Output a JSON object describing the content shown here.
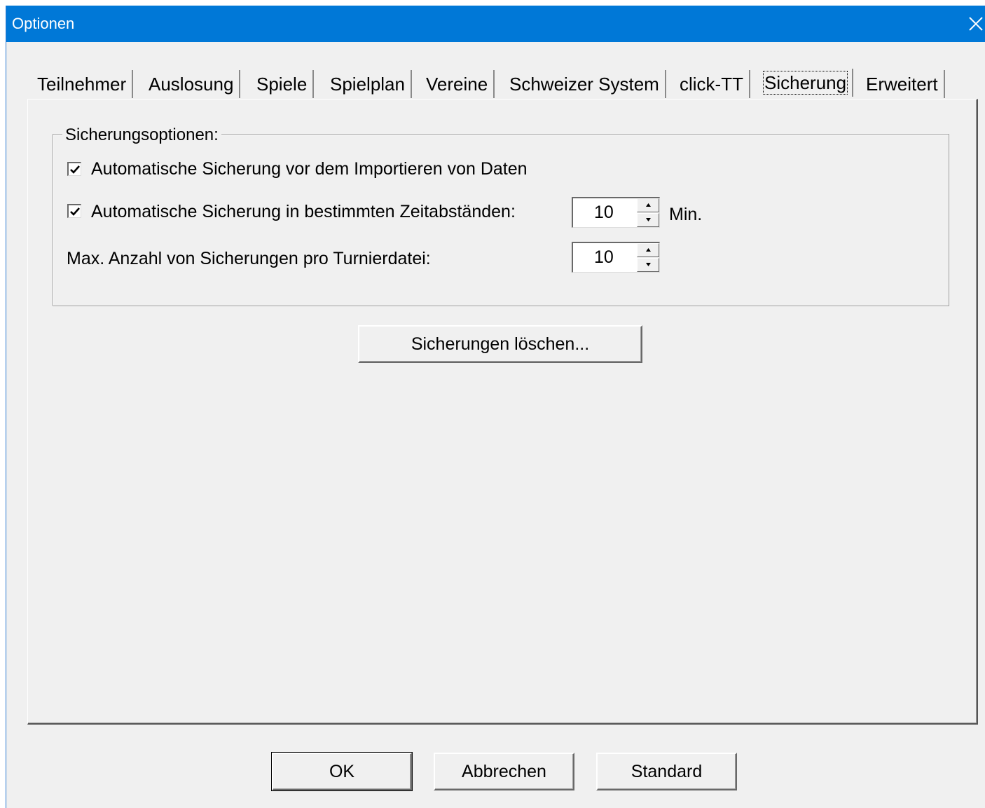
{
  "window": {
    "title": "Optionen"
  },
  "tabs": [
    {
      "label": "Teilnehmer",
      "active": false
    },
    {
      "label": "Auslosung",
      "active": false
    },
    {
      "label": "Spiele",
      "active": false
    },
    {
      "label": "Spielplan",
      "active": false
    },
    {
      "label": "Vereine",
      "active": false
    },
    {
      "label": "Schweizer System",
      "active": false
    },
    {
      "label": "click-TT",
      "active": false
    },
    {
      "label": "Sicherung",
      "active": true
    },
    {
      "label": "Erweitert",
      "active": false
    }
  ],
  "backup_options": {
    "group_title": "Sicherungsoptionen:",
    "auto_backup_import": {
      "label": "Automatische Sicherung vor dem Importieren von Daten",
      "checked": true
    },
    "auto_backup_interval": {
      "label": "Automatische Sicherung in bestimmten Zeitabständen:",
      "checked": true,
      "value": "10",
      "unit": "Min."
    },
    "max_backups": {
      "label": "Max. Anzahl von Sicherungen pro Turnierdatei:",
      "value": "10"
    }
  },
  "delete_backups_button": "Sicherungen löschen...",
  "footer": {
    "ok_label": "OK",
    "cancel_label": "Abbrechen",
    "default_label": "Standard"
  },
  "colors": {
    "titlebar": "#0078d7",
    "dialog_bg": "#f0f0f0"
  }
}
